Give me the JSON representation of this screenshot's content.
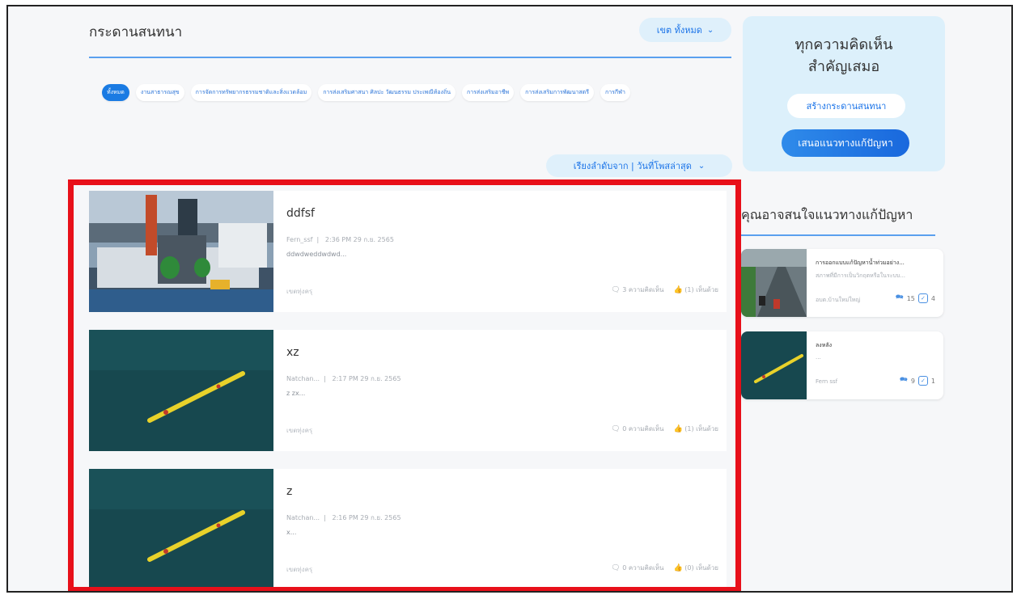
{
  "header": {
    "title": "กระดานสนทนา",
    "zone_filter": "เขต ทั้งหมด"
  },
  "categories": [
    {
      "label": "ทั้งหมด",
      "active": true
    },
    {
      "label": "งานสาธารณสุข",
      "active": false
    },
    {
      "label": "การจัดการทรัพยากรธรรมชาติและสิ่งแวดล้อม",
      "active": false
    },
    {
      "label": "การส่งเสริมศาสนา ศิลปะ วัฒนธรรม ประเพณีท้องถิ่น",
      "active": false
    },
    {
      "label": "การส่งเสริมอาชีพ",
      "active": false
    },
    {
      "label": "การส่งเสริมการพัฒนาสตรี",
      "active": false
    },
    {
      "label": "การกีฬา",
      "active": false
    }
  ],
  "sort": {
    "label": "เรียงลำดับจาก | วันที่โพสล่าสุด"
  },
  "sidebar": {
    "title_line1": "ทุกความคิดเห็น",
    "title_line2": "สำคัญเสมอ",
    "create_button": "สร้างกระดานสนทนา",
    "propose_button": "เสนอแนวทางแก้ปัญหา",
    "suggest_title": "คุณอาจสนใจแนวทางแก้ปัญหา",
    "suggestions": [
      {
        "title": "การออกแบบแก้ปัญหาน้ำท่วมอย่าง...",
        "subtitle": "สภาพที่มีการเป็นวิกฤตหรือในระบบ...",
        "author": "อบต.บ้านใหม่ใหญ่",
        "comments": "15",
        "checks": "4"
      },
      {
        "title": "ลงหลัง",
        "subtitle": "...",
        "author": "Fern ssf",
        "comments": "9",
        "checks": "1"
      }
    ]
  },
  "posts": [
    {
      "title": "ddfsf",
      "author": "Fern_ssf",
      "time": "2:36 PM 29 ก.ย. 2565",
      "desc": "ddwdweddwdwd...",
      "zone": "เขตทุ่งครุ",
      "comments": "3 ความคิดเห็น",
      "agree": "(1) เห็นด้วย"
    },
    {
      "title": "xz",
      "author": "Natchan...",
      "time": "2:17 PM 29 ก.ย. 2565",
      "desc": "z zx...",
      "zone": "เขตทุ่งครุ",
      "comments": "0 ความคิดเห็น",
      "agree": "(1) เห็นด้วย"
    },
    {
      "title": "z",
      "author": "Natchan...",
      "time": "2:16 PM 29 ก.ย. 2565",
      "desc": "x...",
      "zone": "เขตทุ่งครุ",
      "comments": "0 ความคิดเห็น",
      "agree": "(0) เห็นด้วย"
    }
  ],
  "colors": {
    "accent": "#1a73e8",
    "highlight": "#e8101a",
    "panel": "#dcf0fb"
  }
}
